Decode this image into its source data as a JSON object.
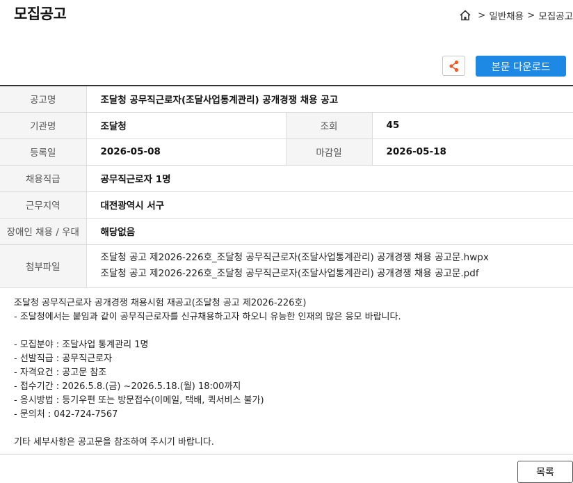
{
  "page": {
    "title": "모집공고"
  },
  "breadcrumb": {
    "items": [
      "일반채용",
      "모집공고"
    ],
    "separator": ">"
  },
  "toolbar": {
    "share_icon": "share-icon",
    "download_label": "본문 다운로드"
  },
  "notice": {
    "title_label": "공고명",
    "title": "조달청 공무직근로자(조달사업통계관리) 공개경쟁 채용 공고",
    "org_label": "기관명",
    "org": "조달청",
    "views_label": "조회",
    "views": "45",
    "reg_label": "등록일",
    "reg_date": "2026-05-08",
    "deadline_label": "마감일",
    "deadline": "2026-05-18",
    "position_label": "채용직급",
    "position": "공무직근로자 1명",
    "region_label": "근무지역",
    "region": "대전광역시 서구",
    "disability_label": "장애인 채용 / 우대",
    "disability": "해당없음",
    "attach_label": "첨부파일",
    "attachments": [
      "조달청 공고 제2026-226호_조달청 공무직근로자(조달사업통계관리) 공개경쟁 채용 공고문.hwpx",
      "조달청 공고 제2026-226호_조달청 공무직근로자(조달사업통계관리) 공개경쟁 채용 공고문.pdf"
    ]
  },
  "content": {
    "lines": [
      "조달청 공무직근로자 공개경쟁 채용시험 재공고(조달청 공고 제2026-226호)",
      "- 조달청에서는 붙임과 같이 공무직근로자를 신규채용하고자 하오니 유능한 인재의 많은 응모 바랍니다.",
      "",
      "- 모집분야 : 조달사업 통계관리 1명",
      "- 선발직급 : 공무직근로자",
      "- 자격요건 : 공고문 참조",
      "- 접수기간 : 2026.5.8.(금) ~2026.5.18.(월) 18:00까지",
      "- 응시방법 : 등기우편 또는 방문접수(이메일, 택배, 퀵서비스 불가)",
      "- 문의처 : 042-724-7567",
      "",
      "기타 세부사항은 공고문을 참조하여 주시기 바랍니다."
    ]
  },
  "footer": {
    "list_label": "목록"
  }
}
